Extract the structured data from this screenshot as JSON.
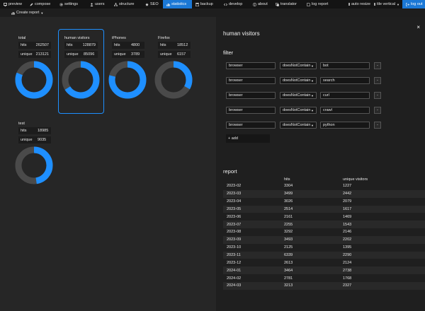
{
  "topnav": {
    "items": [
      {
        "label": "preview",
        "icon": "monitor-icon",
        "active": false
      },
      {
        "label": "compose",
        "icon": "compose-icon",
        "active": false
      },
      {
        "label": "settings",
        "icon": "gear-icon",
        "active": false
      },
      {
        "label": "users",
        "icon": "users-icon",
        "active": false
      },
      {
        "label": "structure",
        "icon": "structure-icon",
        "active": false
      },
      {
        "label": "SEO",
        "icon": "star-icon",
        "active": false
      },
      {
        "label": "statistics",
        "icon": "bar-chart-icon",
        "active": true
      },
      {
        "label": "backup",
        "icon": "backup-icon",
        "active": false
      },
      {
        "label": "develop",
        "icon": "code-icon",
        "active": false
      },
      {
        "label": "about",
        "icon": "info-icon",
        "active": false
      },
      {
        "label": "translator",
        "icon": "translate-icon",
        "active": false
      },
      {
        "label": "log report",
        "icon": "file-icon",
        "active": false
      }
    ],
    "auto_resize": "auto resize",
    "layout_select": "tile vertical",
    "logout": "log out"
  },
  "subnav": {
    "create_report": "Create report"
  },
  "cards": [
    {
      "title": "total",
      "hits_label": "hits",
      "hits": "262507",
      "unique_label": "unique",
      "unique": "213121"
    },
    {
      "title": "human visitors",
      "hits_label": "hits",
      "hits": "128879",
      "unique_label": "unique",
      "unique": "85096"
    },
    {
      "title": "iPhones",
      "hits_label": "hits",
      "hits": "4800",
      "unique_label": "unique",
      "unique": "3789"
    },
    {
      "title": "Firefox",
      "hits_label": "hits",
      "hits": "18512",
      "unique_label": "unique",
      "unique": "6157"
    },
    {
      "title": "test",
      "hits_label": "hits",
      "hits": "18985",
      "unique_label": "unique",
      "unique": "9035"
    }
  ],
  "panel": {
    "title": "human visitors",
    "close": "×",
    "filter_heading": "filter",
    "filters": [
      {
        "field": "browser",
        "op": "doesNotContain",
        "value": "bot",
        "remove": "-"
      },
      {
        "field": "browser",
        "op": "doesNotContain",
        "value": "search",
        "remove": "-"
      },
      {
        "field": "browser",
        "op": "doesNotContain",
        "value": "curl",
        "remove": "-"
      },
      {
        "field": "browser",
        "op": "doesNotContain",
        "value": "crawl",
        "remove": "-"
      },
      {
        "field": "browser",
        "op": "doesNotContain",
        "value": "python",
        "remove": "-"
      }
    ],
    "add_label": "+ add",
    "report_heading": "report",
    "report_columns": [
      "",
      "hits",
      "unique visitors"
    ],
    "report_rows": [
      [
        "2023-02",
        "3304",
        "1227"
      ],
      [
        "2023-03",
        "3499",
        "2442"
      ],
      [
        "2023-04",
        "3026",
        "2079"
      ],
      [
        "2023-05",
        "2514",
        "1617"
      ],
      [
        "2023-06",
        "2161",
        "1469"
      ],
      [
        "2023-07",
        "2255",
        "1543"
      ],
      [
        "2023-08",
        "3292",
        "2146"
      ],
      [
        "2023-09",
        "3493",
        "2202"
      ],
      [
        "2023-10",
        "2125",
        "1395"
      ],
      [
        "2023-11",
        "6339",
        "2290"
      ],
      [
        "2023-12",
        "2613",
        "2124"
      ],
      [
        "2024-01",
        "3464",
        "2738"
      ],
      [
        "2024-02",
        "2781",
        "1768"
      ],
      [
        "2024-03",
        "3213",
        "2327"
      ]
    ]
  },
  "colors": {
    "accent": "#1e8fff",
    "donut_bg": "#4a4a4a",
    "active_nav": "#1b78d6"
  }
}
